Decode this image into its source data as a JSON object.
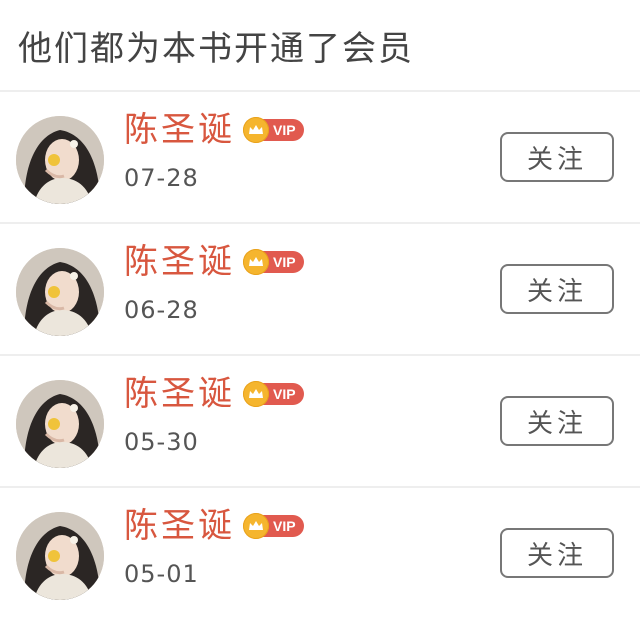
{
  "header": {
    "title": "他们都为本书开通了会员"
  },
  "members": [
    {
      "name": "陈圣诞",
      "badge": "VIP",
      "date": "07-28",
      "follow_label": "关注",
      "avatar_icon": "avatar-photo"
    },
    {
      "name": "陈圣诞",
      "badge": "VIP",
      "date": "06-28",
      "follow_label": "关注",
      "avatar_icon": "avatar-photo"
    },
    {
      "name": "陈圣诞",
      "badge": "VIP",
      "date": "05-30",
      "follow_label": "关注",
      "avatar_icon": "avatar-photo"
    },
    {
      "name": "陈圣诞",
      "badge": "VIP",
      "date": "05-01",
      "follow_label": "关注",
      "avatar_icon": "avatar-photo"
    }
  ],
  "colors": {
    "name": "#d8573f",
    "vip_pill": "#e15a4f",
    "vip_crown": "#f5b52e",
    "divider": "#eeeeee"
  }
}
